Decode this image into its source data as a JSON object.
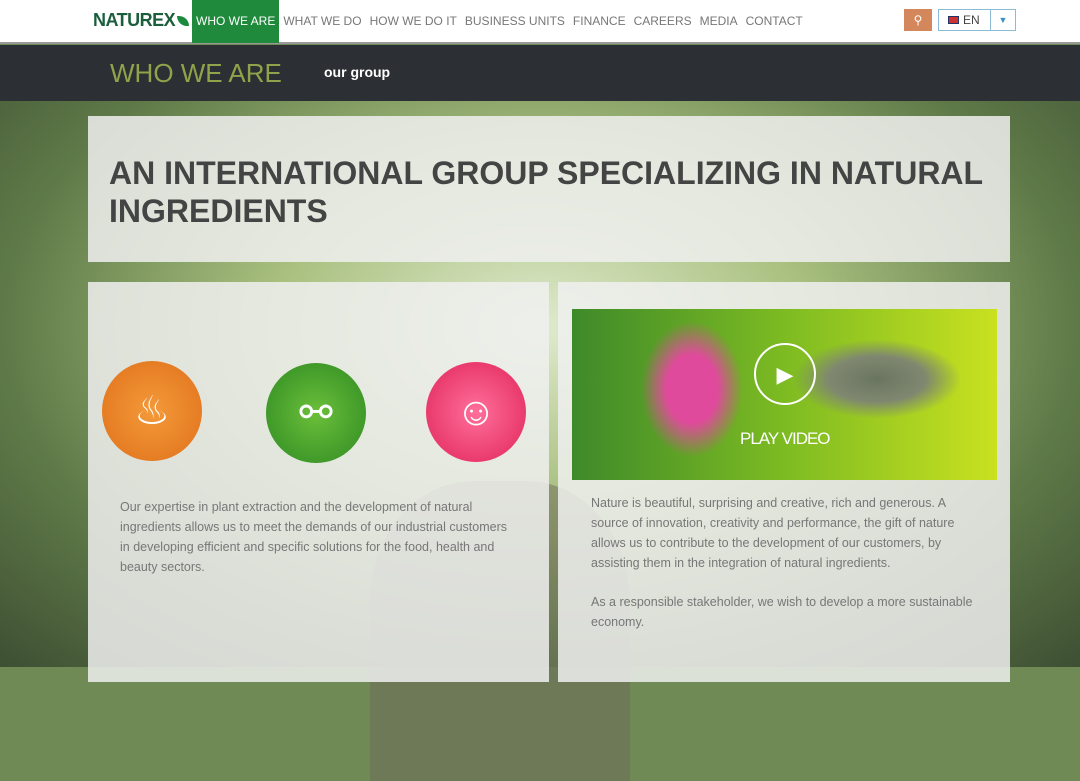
{
  "header": {
    "logo": "NATUREX",
    "nav": [
      "WHO WE ARE",
      "WHAT WE DO",
      "HOW WE DO IT",
      "BUSINESS UNITS",
      "FINANCE",
      "CAREERS",
      "MEDIA",
      "CONTACT"
    ],
    "language": "EN"
  },
  "subheader": {
    "section": "WHO WE ARE",
    "page": "our group"
  },
  "main": {
    "title": "AN INTERNATIONAL GROUP SPECIALIZING IN NATURAL INGREDIENTS",
    "left_text": "Our expertise in plant extraction and the development of natural ingredients allows us to meet the demands of our industrial customers in developing efficient and specific solutions for the food, health and beauty sectors.",
    "video_label": "PLAY VIDEO",
    "right_text_1": "Nature is beautiful, surprising and creative, rich and generous. A source of innovation, creativity and performance, the gift of nature allows us to contribute to the development of our customers, by assisting them in the integration of natural ingredients.",
    "right_text_2": "As a responsible stakeholder, we wish to develop a more sustainable economy."
  }
}
